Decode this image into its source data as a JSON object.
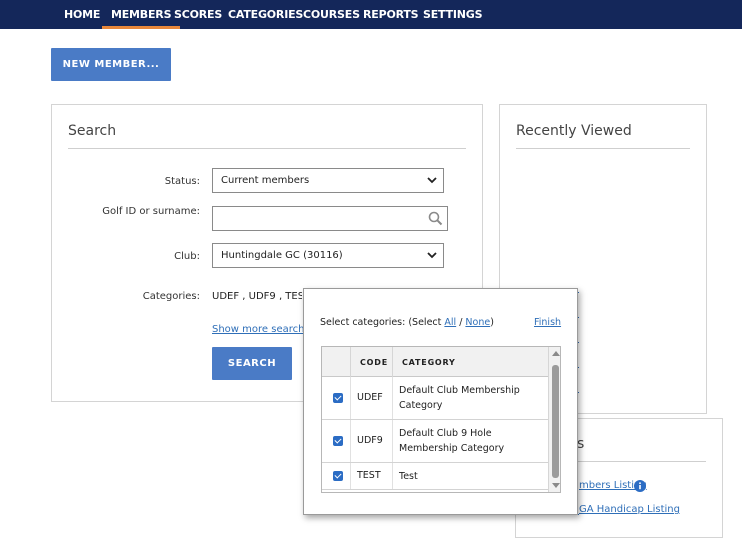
{
  "nav": {
    "items": [
      "HOME",
      "MEMBERS",
      "SCORES",
      "CATEGORIES",
      "COURSES",
      "REPORTS",
      "SETTINGS"
    ],
    "active": "MEMBERS"
  },
  "new_member_button": "NEW MEMBER...",
  "search": {
    "title": "Search",
    "status_label": "Status:",
    "status_value": "Current members",
    "golfid_label": "Golf ID or surname:",
    "golfid_value": "",
    "club_label": "Club:",
    "club_value": "Huntingdale GC (30116)",
    "categories_label": "Categories:",
    "categories_value": "UDEF , UDF9 , TEST",
    "more_link": "Show more search o",
    "search_button": "SEARCH"
  },
  "recently_viewed": {
    "title": "Recently Viewed"
  },
  "reports_panel": {
    "title_fragment": "s",
    "links": [
      "mbers Listing",
      "GA Handicap Listing"
    ]
  },
  "popup": {
    "prompt_prefix": "Select categories: (Select ",
    "all_link": "All",
    "slash": " / ",
    "none_link": "None",
    "prompt_suffix": ")",
    "finish_link": "Finish",
    "columns": [
      "CODE",
      "CATEGORY"
    ],
    "rows": [
      {
        "checked": true,
        "code": "UDEF",
        "category": "Default Club Membership Category"
      },
      {
        "checked": true,
        "code": "UDF9",
        "category": "Default Club 9 Hole Membership Category"
      },
      {
        "checked": true,
        "code": "TEST",
        "category": "Test"
      }
    ]
  },
  "colors": {
    "nav_bg": "#14275a",
    "active_underline": "#e8873a",
    "button": "#4a7bc6",
    "link": "#2f6fb8",
    "checkbox": "#2b6cc4"
  }
}
